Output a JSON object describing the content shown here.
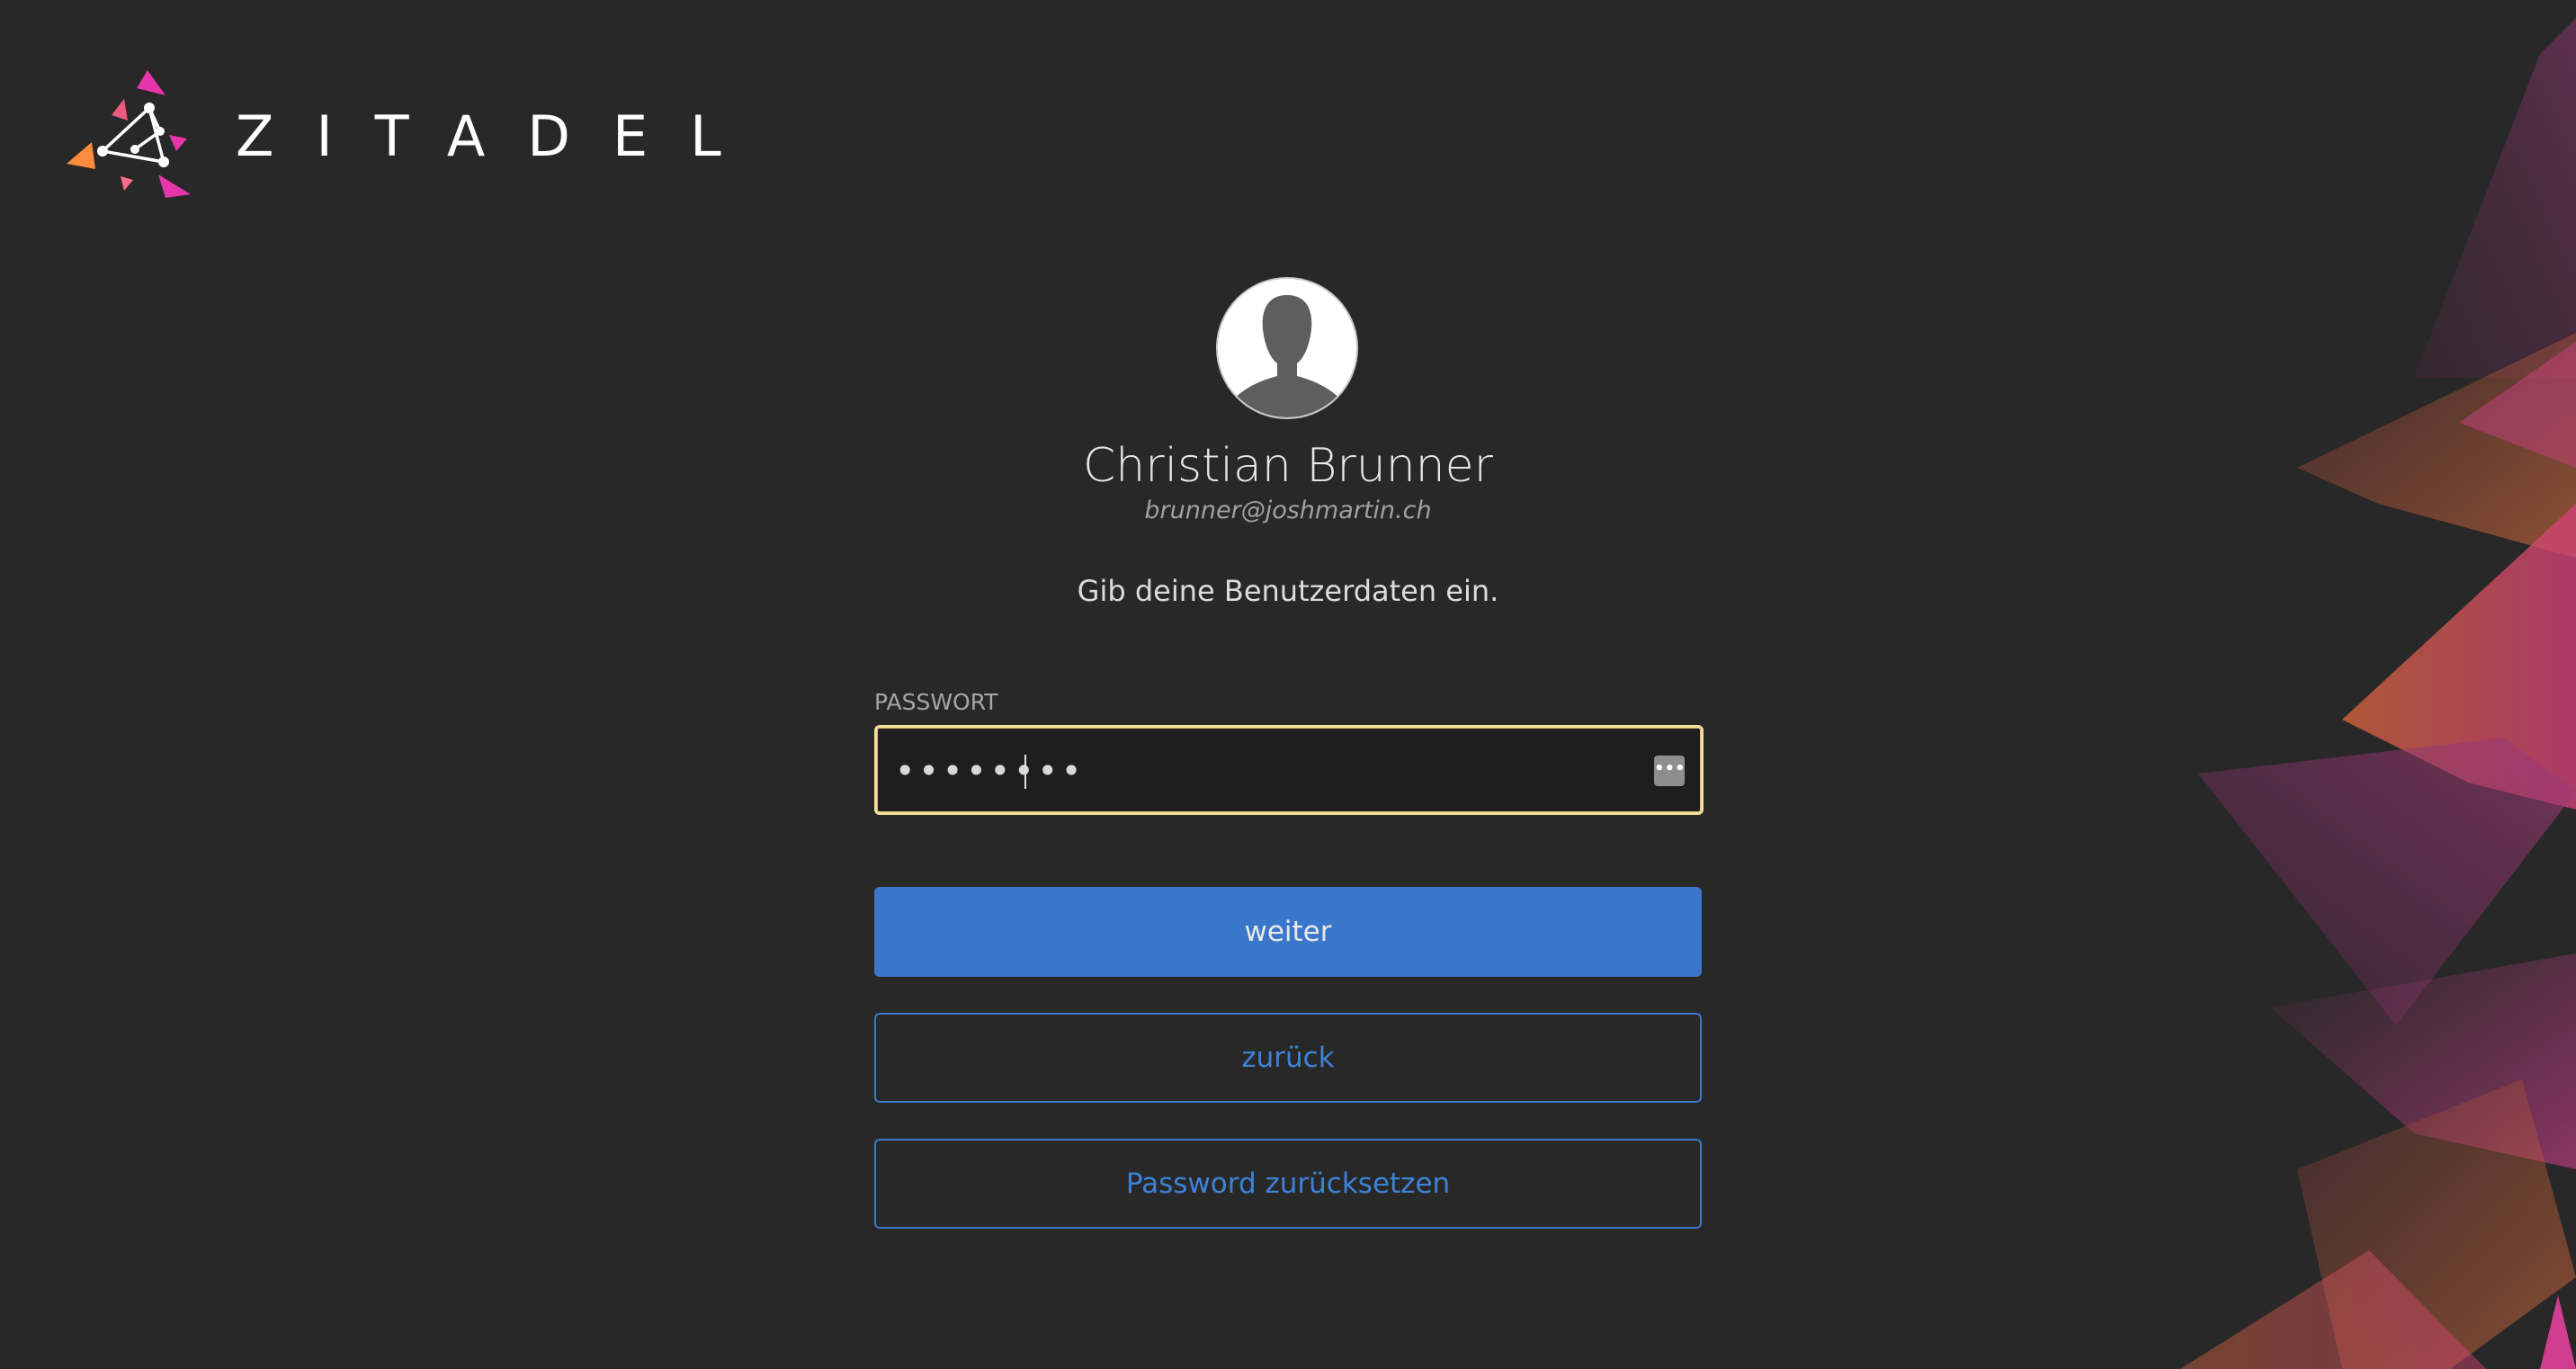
{
  "brand": {
    "name": "ZITADEL",
    "colors": {
      "pink": "#e535ab",
      "orange": "#ff8b3d",
      "accent_blue": "#3a77ca",
      "focus_ring": "#f2dd9b",
      "background": "#282828"
    }
  },
  "user": {
    "display_name": "Christian Brunner",
    "login_name": "brunner@joshmartin.ch",
    "avatar_icon": "user-silhouette-icon"
  },
  "instruction": "Gib deine Benutzerdaten ein.",
  "password_field": {
    "label": "PASSWORT",
    "value": "••••••••",
    "type": "password",
    "keychain_icon": "password-manager-icon",
    "keychain_glyph": "•••"
  },
  "buttons": {
    "next": "weiter",
    "back": "zurück",
    "reset_password": "Password zurücksetzen"
  }
}
